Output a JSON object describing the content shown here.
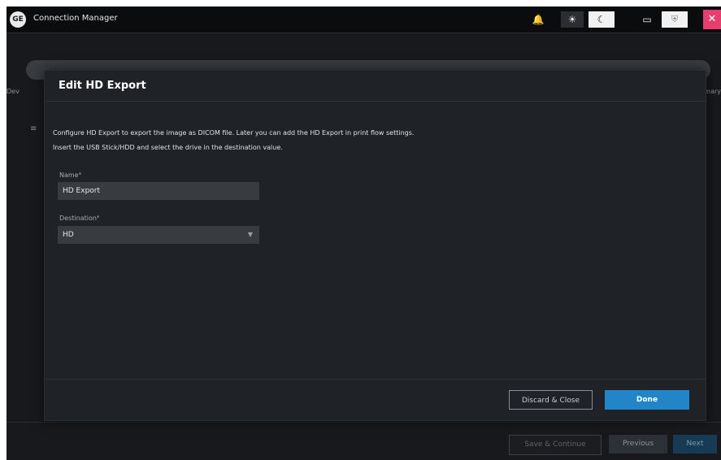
{
  "app": {
    "title": "Connection Manager",
    "logo_text": "GE"
  },
  "titlebar": {
    "bell_icon": "bell-icon",
    "sun_icon": "sun-icon",
    "moon_icon": "moon-icon",
    "monitor_icon": "monitor-icon",
    "shield_icon": "shield-icon",
    "close_icon": "close-icon"
  },
  "background": {
    "left_step_label": "Dev",
    "right_step_label": "mary"
  },
  "footer": {
    "save_label": "Save & Continue",
    "previous_label": "Previous",
    "next_label": "Next"
  },
  "dialog": {
    "title": "Edit HD Export",
    "description_line1": "Configure HD Export to export the image as DICOM file. Later you can add the HD Export in print flow settings.",
    "description_line2": "Insert the USB Stick/HDD and select the drive in the destination value.",
    "name_label": "Name",
    "name_required": "*",
    "name_value": "HD Export",
    "destination_label": "Destination",
    "destination_required": "*",
    "destination_value": "HD",
    "discard_label": "Discard & Close",
    "done_label": "Done"
  },
  "colors": {
    "accent": "#2185c7",
    "close": "#e63f6d",
    "background": "#17191c",
    "dialog": "#1f2226"
  }
}
